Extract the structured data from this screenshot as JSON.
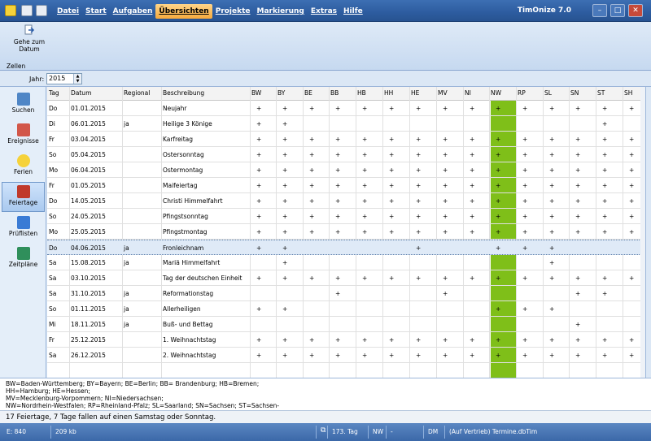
{
  "app": {
    "title": "TimOnize 7.0"
  },
  "menu": [
    "Datei",
    "Start",
    "Aufgaben",
    "Übersichten",
    "Projekte",
    "Markierung",
    "Extras",
    "Hilfe"
  ],
  "menu_active": "Übersichten",
  "ribbon": {
    "goto_label_line1": "Gehe zum",
    "goto_label_line2": "Datum",
    "group_label": "Zellen"
  },
  "year": {
    "label": "Jahr:",
    "value": "2015"
  },
  "sidebar": [
    "Suchen",
    "Ereignisse",
    "Ferien",
    "Feiertage",
    "Prüflisten",
    "Zeitpläne"
  ],
  "sidebar_active": "Feiertage",
  "table": {
    "columns": [
      "Tag",
      "Datum",
      "Regional",
      "Beschreibung",
      "BW",
      "BY",
      "BE",
      "BB",
      "HB",
      "HH",
      "HE",
      "MV",
      "NI",
      "NW",
      "RP",
      "SL",
      "SN",
      "ST",
      "SH"
    ],
    "highlight_column": "NW",
    "highlight_color": "#7fbf19",
    "selected_row": 9,
    "rows": [
      [
        "Do",
        "01.01.2015",
        "",
        "Neujahr",
        "+",
        "+",
        "+",
        "+",
        "+",
        "+",
        "+",
        "+",
        "+",
        "+",
        "+",
        "+",
        "+",
        "+",
        "+"
      ],
      [
        "Di",
        "06.01.2015",
        "ja",
        "Heilige 3 Könige",
        "+",
        "+",
        "",
        "",
        "",
        "",
        "",
        "",
        "",
        "",
        "",
        "",
        "",
        "+",
        ""
      ],
      [
        "Fr",
        "03.04.2015",
        "",
        "Karfreitag",
        "+",
        "+",
        "+",
        "+",
        "+",
        "+",
        "+",
        "+",
        "+",
        "+",
        "+",
        "+",
        "+",
        "+",
        "+"
      ],
      [
        "So",
        "05.04.2015",
        "",
        "Ostersonntag",
        "+",
        "+",
        "+",
        "+",
        "+",
        "+",
        "+",
        "+",
        "+",
        "+",
        "+",
        "+",
        "+",
        "+",
        "+"
      ],
      [
        "Mo",
        "06.04.2015",
        "",
        "Ostermontag",
        "+",
        "+",
        "+",
        "+",
        "+",
        "+",
        "+",
        "+",
        "+",
        "+",
        "+",
        "+",
        "+",
        "+",
        "+"
      ],
      [
        "Fr",
        "01.05.2015",
        "",
        "Maifeiertag",
        "+",
        "+",
        "+",
        "+",
        "+",
        "+",
        "+",
        "+",
        "+",
        "+",
        "+",
        "+",
        "+",
        "+",
        "+"
      ],
      [
        "Do",
        "14.05.2015",
        "",
        "Christi Himmelfahrt",
        "+",
        "+",
        "+",
        "+",
        "+",
        "+",
        "+",
        "+",
        "+",
        "+",
        "+",
        "+",
        "+",
        "+",
        "+"
      ],
      [
        "So",
        "24.05.2015",
        "",
        "Pfingstsonntag",
        "+",
        "+",
        "+",
        "+",
        "+",
        "+",
        "+",
        "+",
        "+",
        "+",
        "+",
        "+",
        "+",
        "+",
        "+"
      ],
      [
        "Mo",
        "25.05.2015",
        "",
        "Pfingstmontag",
        "+",
        "+",
        "+",
        "+",
        "+",
        "+",
        "+",
        "+",
        "+",
        "+",
        "+",
        "+",
        "+",
        "+",
        "+"
      ],
      [
        "Do",
        "04.06.2015",
        "ja",
        "Fronleichnam",
        "+",
        "+",
        "",
        "",
        "",
        "",
        "+",
        "",
        "",
        "+",
        "+",
        "+",
        "",
        "",
        ""
      ],
      [
        "Sa",
        "15.08.2015",
        "ja",
        "Mariä Himmelfahrt",
        "",
        "+",
        "",
        "",
        "",
        "",
        "",
        "",
        "",
        "",
        "",
        "+",
        "",
        "",
        ""
      ],
      [
        "Sa",
        "03.10.2015",
        "",
        "Tag der deutschen Einheit",
        "+",
        "+",
        "+",
        "+",
        "+",
        "+",
        "+",
        "+",
        "+",
        "+",
        "+",
        "+",
        "+",
        "+",
        "+"
      ],
      [
        "Sa",
        "31.10.2015",
        "ja",
        "Reformationstag",
        "",
        "",
        "",
        "+",
        "",
        "",
        "",
        "+",
        "",
        "",
        "",
        "",
        "+",
        "+",
        ""
      ],
      [
        "So",
        "01.11.2015",
        "ja",
        "Allerheiligen",
        "+",
        "+",
        "",
        "",
        "",
        "",
        "",
        "",
        "",
        "+",
        "+",
        "+",
        "",
        "",
        ""
      ],
      [
        "Mi",
        "18.11.2015",
        "ja",
        "Buß- und Bettag",
        "",
        "",
        "",
        "",
        "",
        "",
        "",
        "",
        "",
        "",
        "",
        "",
        "+",
        "",
        ""
      ],
      [
        "Fr",
        "25.12.2015",
        "",
        "1. Weihnachtstag",
        "+",
        "+",
        "+",
        "+",
        "+",
        "+",
        "+",
        "+",
        "+",
        "+",
        "+",
        "+",
        "+",
        "+",
        "+"
      ],
      [
        "Sa",
        "26.12.2015",
        "",
        "2. Weihnachtstag",
        "+",
        "+",
        "+",
        "+",
        "+",
        "+",
        "+",
        "+",
        "+",
        "+",
        "+",
        "+",
        "+",
        "+",
        "+"
      ]
    ]
  },
  "legend": [
    "BW=Baden-Württemberg; BY=Bayern; BE=Berlin; BB= Brandenburg; HB=Bremen;",
    "HH=Hamburg; HE=Hessen;",
    "MV=Mecklenburg-Vorpommern; NI=Niedersachsen;",
    "NW=Nordrhein-Westfalen; RP=Rheinland-Pfalz; SL=Saarland; SN=Sachsen; ST=Sachsen-"
  ],
  "summary": "17 Feiertage, 7 Tage fallen auf einen Samstag oder Sonntag.",
  "status": {
    "entries": "E: 840",
    "size": "209 kb",
    "day": "173. Tag",
    "nw": "NW",
    "dash": "-",
    "dm": "DM",
    "file": "(Auf Vertrieb) Termine.dbTim"
  }
}
